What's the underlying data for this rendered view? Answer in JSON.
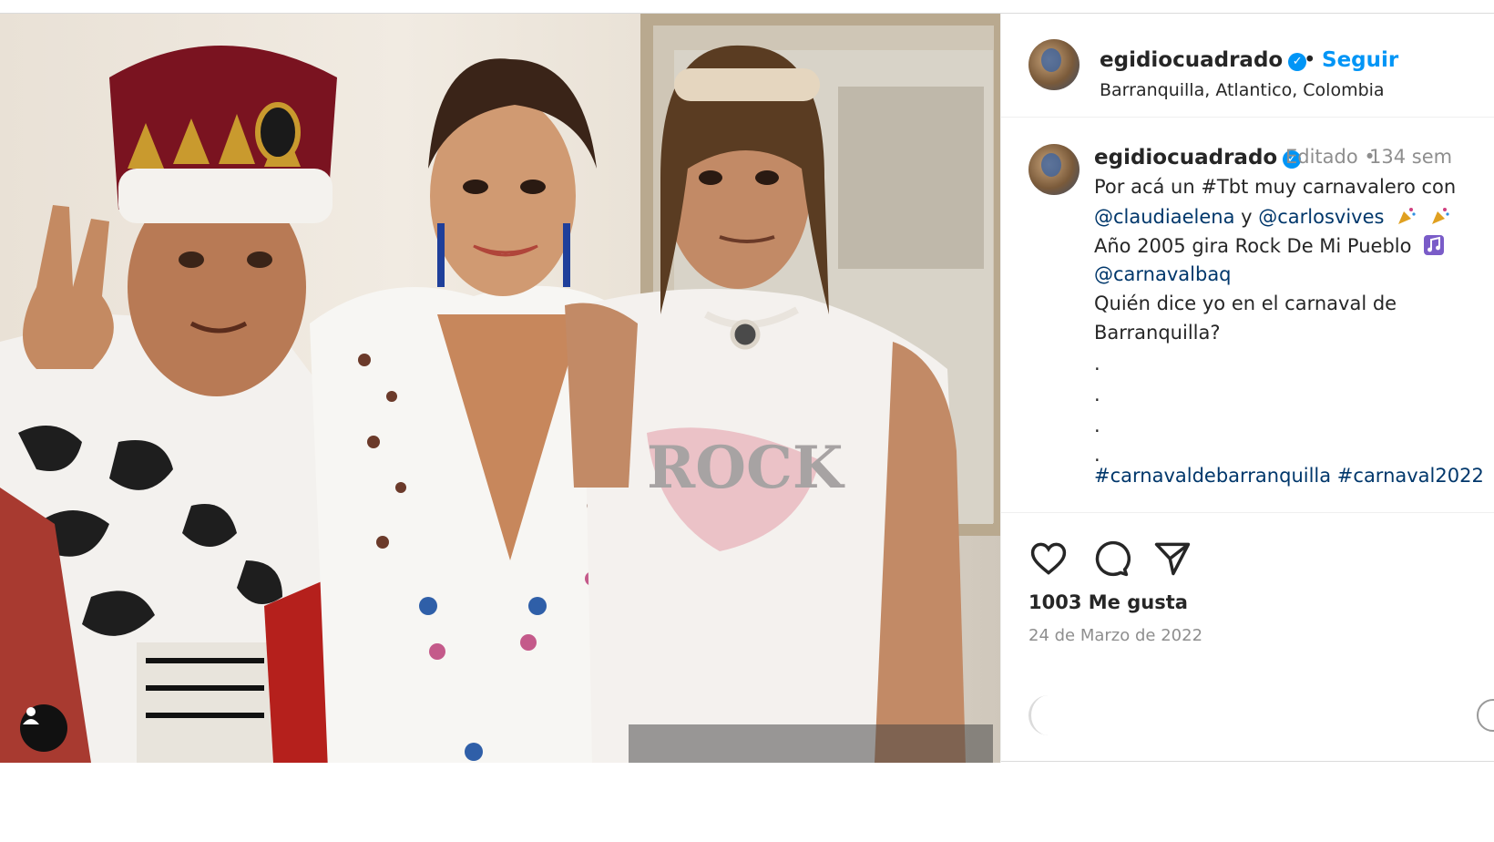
{
  "post": {
    "username": "egidiocuadrado",
    "follow_label": "Seguir",
    "separator": "•",
    "location": "Barranquilla, Atlantico, Colombia"
  },
  "caption": {
    "username": "egidiocuadrado",
    "edited": "Editado •",
    "age": "134 sem",
    "line1": "Por acá un #Tbt muy carnavalero con",
    "mention1": "@claudiaelena",
    "conj": " y ",
    "mention2": "@carlosvives",
    "line3": "Año 2005 gira Rock De Mi Pueblo",
    "mention3": "@carnavalbaq",
    "line5": "Quién dice yo en el carnaval de",
    "line6": "Barranquilla?",
    "dot1": ".",
    "dot2": ".",
    "dot3": ".",
    "dot4": ".",
    "hashtags": "#carnavaldebarranquilla #carnaval2022"
  },
  "actions": {
    "like_icon": "heart-icon",
    "comment_icon": "comment-icon",
    "share_icon": "paper-plane-icon",
    "likes": "1003 Me gusta",
    "date": "24 de Marzo de 2022"
  }
}
